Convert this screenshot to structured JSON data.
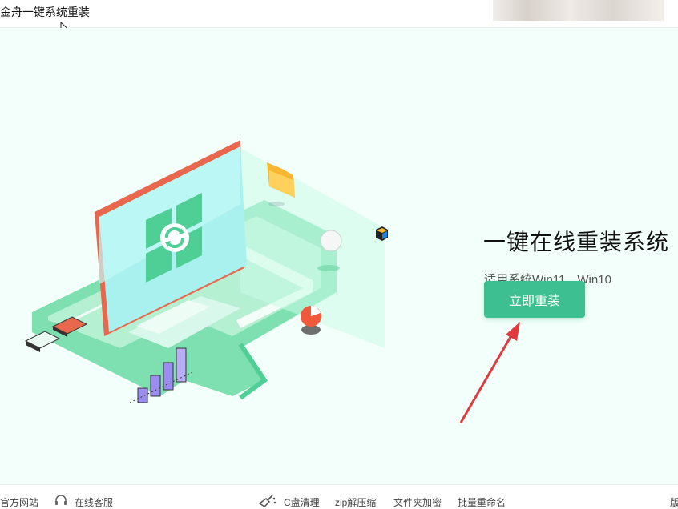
{
  "app": {
    "title": "金舟一键系统重装"
  },
  "hero": {
    "title": "一键在线重装系统",
    "subtitle": "适用系统Win11、Win10",
    "button_label": "立即重装"
  },
  "footer": {
    "items": [
      {
        "label": "官方网站",
        "icon": ""
      },
      {
        "label": "在线客服",
        "icon": "headset-icon"
      },
      {
        "label": "C盘清理",
        "icon": "broom-icon"
      },
      {
        "label": "zip解压缩",
        "icon": ""
      },
      {
        "label": "文件夹加密",
        "icon": ""
      },
      {
        "label": "批量重命名",
        "icon": ""
      }
    ],
    "version_label": "版"
  },
  "colors": {
    "accent": "#3dbf91",
    "background": "#f3fffa",
    "annotation_arrow": "#e0393e"
  }
}
